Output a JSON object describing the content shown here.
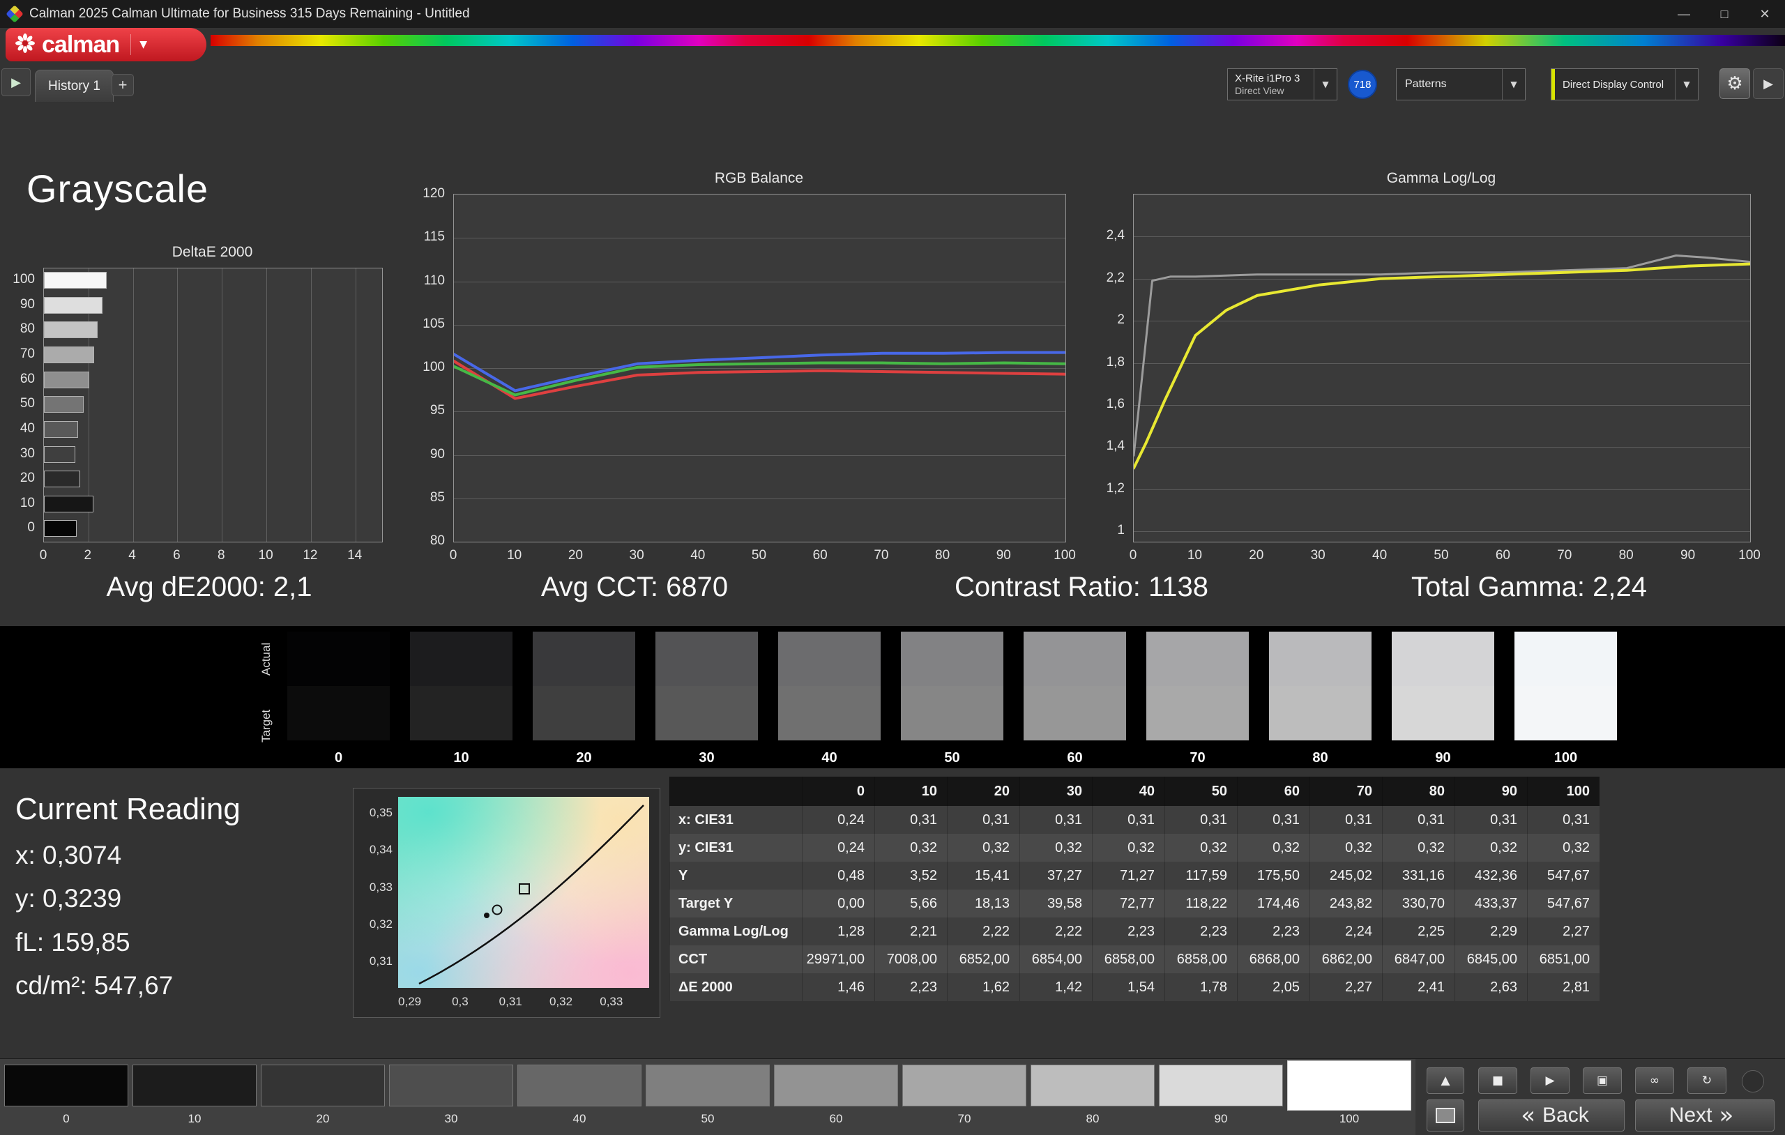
{
  "window": {
    "title": "Calman 2025 Calman Ultimate for Business 315 Days Remaining  - Untitled"
  },
  "logo": {
    "text": "calman"
  },
  "nav": {
    "history_tab": "History 1",
    "add_tab": "+"
  },
  "toolbar": {
    "meter_line1": "X-Rite i1Pro 3",
    "meter_line2": "Direct View",
    "badge": "718",
    "patterns_label": "Patterns",
    "display_control_label": "Direct Display Control"
  },
  "page_title": "Grayscale",
  "stats": {
    "de2000": "Avg dE2000: 2,1",
    "cct": "Avg CCT: 6870",
    "contrast": "Contrast Ratio: 1138",
    "gamma": "Total Gamma: 2,24"
  },
  "chart_data": [
    {
      "type": "bar",
      "orientation": "horizontal",
      "title": "DeltaE 2000",
      "categories": [
        "100",
        "90",
        "80",
        "70",
        "60",
        "50",
        "40",
        "30",
        "20",
        "10",
        "0"
      ],
      "values": [
        2.81,
        2.63,
        2.41,
        2.27,
        2.05,
        1.78,
        1.54,
        1.42,
        1.62,
        2.23,
        1.46
      ],
      "bar_colors": [
        "#f6f6f6",
        "#dedede",
        "#c4c4c4",
        "#ababab",
        "#8f8f8f",
        "#747474",
        "#595959",
        "#3f3f3f",
        "#2a2a2a",
        "#161616",
        "#060606"
      ],
      "xlim": [
        0,
        15.2
      ],
      "xtick_values": [
        0,
        2,
        4,
        6,
        8,
        10,
        12,
        14
      ],
      "xtick_labels": [
        "0",
        "2",
        "4",
        "6",
        "8",
        "10",
        "12",
        "14"
      ],
      "grid": "vertical"
    },
    {
      "type": "line",
      "title": "RGB Balance",
      "xlim": [
        0,
        100
      ],
      "ylim": [
        80,
        120
      ],
      "xtick_values": [
        0,
        10,
        20,
        30,
        40,
        50,
        60,
        70,
        80,
        90,
        100
      ],
      "xtick_labels": [
        "0",
        "10",
        "20",
        "30",
        "40",
        "50",
        "60",
        "70",
        "80",
        "90",
        "100"
      ],
      "ytick_values": [
        120,
        115,
        110,
        105,
        100,
        95,
        90,
        85,
        80
      ],
      "ytick_labels": [
        "120",
        "115",
        "110",
        "105",
        "100",
        "95",
        "90",
        "85",
        "80"
      ],
      "ygrid_values": [
        115,
        110,
        105,
        100,
        95,
        90,
        85
      ],
      "x": [
        0,
        10,
        20,
        30,
        40,
        50,
        60,
        70,
        80,
        90,
        100
      ],
      "series": [
        {
          "name": "red-balance-line",
          "color": "#de4040",
          "width": 4,
          "values": [
            100.8,
            96.5,
            97.9,
            99.2,
            99.5,
            99.6,
            99.7,
            99.6,
            99.5,
            99.4,
            99.3
          ]
        },
        {
          "name": "green-balance-line",
          "color": "#46b846",
          "width": 4,
          "values": [
            100.2,
            96.9,
            98.6,
            100.1,
            100.4,
            100.5,
            100.6,
            100.6,
            100.5,
            100.6,
            100.5
          ]
        },
        {
          "name": "blue-balance-line",
          "color": "#4868e8",
          "width": 4,
          "values": [
            101.6,
            97.4,
            99.0,
            100.5,
            100.9,
            101.2,
            101.5,
            101.7,
            101.7,
            101.8,
            101.8
          ]
        }
      ],
      "grid": "horizontal",
      "legend": "none"
    },
    {
      "type": "line",
      "title": "Gamma Log/Log",
      "xlim": [
        0,
        100
      ],
      "ylim": [
        0.95,
        2.6
      ],
      "xtick_values": [
        0,
        10,
        20,
        30,
        40,
        50,
        60,
        70,
        80,
        90,
        100
      ],
      "xtick_labels": [
        "0",
        "10",
        "20",
        "30",
        "40",
        "50",
        "60",
        "70",
        "80",
        "90",
        "100"
      ],
      "ytick_values": [
        2.4,
        2.2,
        2.0,
        1.8,
        1.6,
        1.4,
        1.2,
        1.0
      ],
      "ytick_labels": [
        "2,4",
        "2,2",
        "2",
        "1,8",
        "1,6",
        "1,4",
        "1,2",
        "1"
      ],
      "ygrid_values": [
        2.4,
        2.2,
        2.0,
        1.8,
        1.6,
        1.4,
        1.2,
        1.0
      ],
      "series": [
        {
          "name": "gamma-reference-line",
          "color": "#9c9c9c",
          "width": 3,
          "x": [
            0,
            3,
            6,
            10,
            20,
            30,
            40,
            50,
            60,
            70,
            80,
            88,
            93,
            100
          ],
          "values": [
            1.36,
            2.19,
            2.21,
            2.21,
            2.22,
            2.22,
            2.22,
            2.23,
            2.23,
            2.24,
            2.25,
            2.31,
            2.3,
            2.28
          ]
        },
        {
          "name": "gamma-measured-line",
          "color": "#e8e832",
          "width": 4,
          "x": [
            0,
            2,
            5,
            10,
            15,
            20,
            30,
            40,
            50,
            60,
            70,
            80,
            90,
            100
          ],
          "values": [
            1.3,
            1.42,
            1.62,
            1.93,
            2.05,
            2.12,
            2.17,
            2.2,
            2.21,
            2.22,
            2.23,
            2.24,
            2.26,
            2.27
          ]
        }
      ],
      "grid": "horizontal",
      "legend": "none"
    },
    {
      "type": "scatter",
      "title": "CIE xy chromaticity",
      "xlim": [
        0.2877,
        0.3375
      ],
      "ylim": [
        0.3029,
        0.3543
      ],
      "xtick_values": [
        0.29,
        0.3,
        0.31,
        0.32,
        0.33
      ],
      "xtick_labels": [
        "0,29",
        "0,3",
        "0,31",
        "0,32",
        "0,33"
      ],
      "ytick_values": [
        0.35,
        0.34,
        0.33,
        0.32,
        0.31
      ],
      "ytick_labels": [
        "0,35",
        "0,34",
        "0,33",
        "0,32",
        "0,31"
      ],
      "points": [
        {
          "name": "measured-ring",
          "x": 0.3074,
          "y": 0.3239
        },
        {
          "name": "measured-dot",
          "x": 0.3052,
          "y": 0.3224
        },
        {
          "name": "target-square",
          "x": 0.3127,
          "y": 0.3295
        }
      ]
    }
  ],
  "swatch_band": {
    "actual_label": "Actual",
    "target_label": "Target",
    "items": [
      {
        "label": "0",
        "actual": "#030304",
        "target": "#0c0c0c"
      },
      {
        "label": "10",
        "actual": "#1c1c1e",
        "target": "#232323"
      },
      {
        "label": "20",
        "actual": "#39393b",
        "target": "#3f3f3f"
      },
      {
        "label": "30",
        "actual": "#535355",
        "target": "#585858"
      },
      {
        "label": "40",
        "actual": "#6c6c6e",
        "target": "#707070"
      },
      {
        "label": "50",
        "actual": "#828284",
        "target": "#868686"
      },
      {
        "label": "60",
        "actual": "#949496",
        "target": "#979797"
      },
      {
        "label": "70",
        "actual": "#a6a6a8",
        "target": "#a9a9a9"
      },
      {
        "label": "80",
        "actual": "#bababc",
        "target": "#bdbdbd"
      },
      {
        "label": "90",
        "actual": "#d4d4d6",
        "target": "#d7d7d7"
      },
      {
        "label": "100",
        "actual": "#f2f5f8",
        "target": "#f4f6f8"
      }
    ]
  },
  "current_reading": {
    "title": "Current Reading",
    "x": "x: 0,3074",
    "y": "y: 0,3239",
    "fl": "fL: 159,85",
    "cd": "cd/m²: 547,67"
  },
  "table": {
    "columns": [
      "0",
      "10",
      "20",
      "30",
      "40",
      "50",
      "60",
      "70",
      "80",
      "90",
      "100"
    ],
    "rows": [
      {
        "label": "x: CIE31",
        "values": [
          "0,24",
          "0,31",
          "0,31",
          "0,31",
          "0,31",
          "0,31",
          "0,31",
          "0,31",
          "0,31",
          "0,31",
          "0,31"
        ]
      },
      {
        "label": "y: CIE31",
        "values": [
          "0,24",
          "0,32",
          "0,32",
          "0,32",
          "0,32",
          "0,32",
          "0,32",
          "0,32",
          "0,32",
          "0,32",
          "0,32"
        ]
      },
      {
        "label": "Y",
        "values": [
          "0,48",
          "3,52",
          "15,41",
          "37,27",
          "71,27",
          "117,59",
          "175,50",
          "245,02",
          "331,16",
          "432,36",
          "547,67"
        ]
      },
      {
        "label": "Target Y",
        "values": [
          "0,00",
          "5,66",
          "18,13",
          "39,58",
          "72,77",
          "118,22",
          "174,46",
          "243,82",
          "330,70",
          "433,37",
          "547,67"
        ]
      },
      {
        "label": "Gamma Log/Log",
        "values": [
          "1,28",
          "2,21",
          "2,22",
          "2,22",
          "2,23",
          "2,23",
          "2,23",
          "2,24",
          "2,25",
          "2,29",
          "2,27"
        ]
      },
      {
        "label": "CCT",
        "values": [
          "29971,00",
          "7008,00",
          "6852,00",
          "6854,00",
          "6858,00",
          "6858,00",
          "6868,00",
          "6862,00",
          "6847,00",
          "6845,00",
          "6851,00"
        ]
      },
      {
        "label": "ΔE 2000",
        "values": [
          "1,46",
          "2,23",
          "1,62",
          "1,42",
          "1,54",
          "1,78",
          "2,05",
          "2,27",
          "2,41",
          "2,63",
          "2,81"
        ]
      }
    ]
  },
  "bottom_patches": {
    "active": "100",
    "items": [
      {
        "label": "0",
        "color": "#080808"
      },
      {
        "label": "10",
        "color": "#1c1c1c"
      },
      {
        "label": "20",
        "color": "#343434"
      },
      {
        "label": "30",
        "color": "#4e4e4e"
      },
      {
        "label": "40",
        "color": "#676767"
      },
      {
        "label": "50",
        "color": "#7f7f7f"
      },
      {
        "label": "60",
        "color": "#939393"
      },
      {
        "label": "70",
        "color": "#a7a7a7"
      },
      {
        "label": "80",
        "color": "#bdbdbd"
      },
      {
        "label": "90",
        "color": "#dadada"
      },
      {
        "label": "100",
        "color": "#ffffff"
      }
    ]
  },
  "transport": {
    "back": "Back",
    "next": "Next",
    "back_arrow": "«",
    "next_arrow": "»"
  },
  "icons": {
    "minimize": "—",
    "maximize": "□",
    "close": "✕",
    "caret": "▼",
    "nav_arrow": "▶",
    "gear": "⚙",
    "eject": "▲",
    "stop": "■",
    "play": "▶",
    "window": "▣",
    "loop": "∞",
    "refresh": "↻"
  }
}
